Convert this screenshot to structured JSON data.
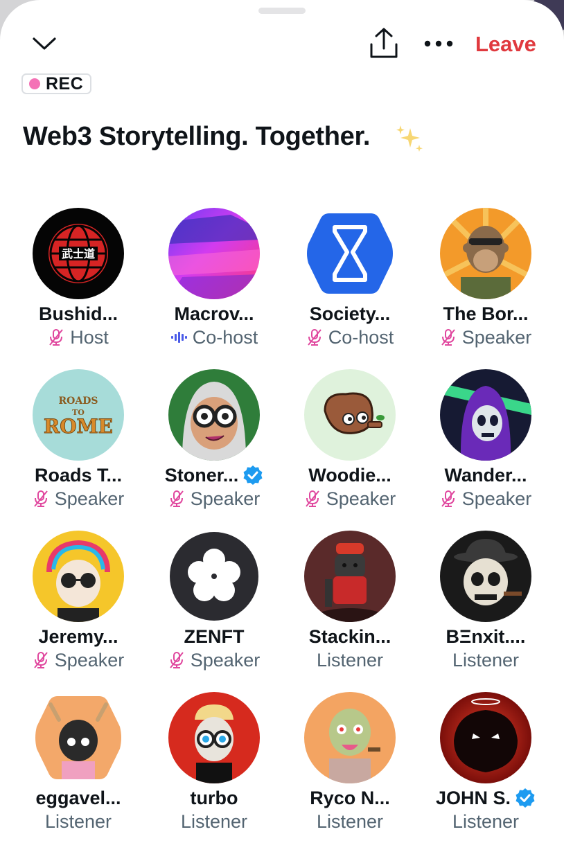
{
  "header": {
    "leave_label": "Leave",
    "collapse_icon": "chevron-down-icon",
    "share_icon": "share-icon",
    "more_icon": "more-horizontal-icon",
    "rec_label": "REC",
    "rec_color": "#f472b6",
    "leave_color": "#e0393e"
  },
  "space": {
    "title": "Web3 Storytelling. Together.",
    "title_emoji": "sparkles-icon"
  },
  "participants": [
    {
      "name": "Bushid...",
      "role": "Host",
      "status": "muted",
      "verified": false
    },
    {
      "name": "Macrov...",
      "role": "Co-host",
      "status": "speaking",
      "verified": false
    },
    {
      "name": "Society...",
      "role": "Co-host",
      "status": "muted",
      "verified": false
    },
    {
      "name": "The Bor...",
      "role": "Speaker",
      "status": "muted",
      "verified": false
    },
    {
      "name": "Roads T...",
      "role": "Speaker",
      "status": "muted",
      "verified": false
    },
    {
      "name": "Stoner...",
      "role": "Speaker",
      "status": "muted",
      "verified": true
    },
    {
      "name": "Woodie...",
      "role": "Speaker",
      "status": "muted",
      "verified": false
    },
    {
      "name": "Wander...",
      "role": "Speaker",
      "status": "muted",
      "verified": false
    },
    {
      "name": "Jeremy...",
      "role": "Speaker",
      "status": "muted",
      "verified": false
    },
    {
      "name": "ZENFT",
      "role": "Speaker",
      "status": "muted",
      "verified": false
    },
    {
      "name": "Stackin...",
      "role": "Listener",
      "status": "none",
      "verified": false
    },
    {
      "name": "BΞnxit....",
      "role": "Listener",
      "status": "none",
      "verified": false
    },
    {
      "name": "eggavel...",
      "role": "Listener",
      "status": "none",
      "verified": false
    },
    {
      "name": "turbo",
      "role": "Listener",
      "status": "none",
      "verified": false
    },
    {
      "name": "Ryco N...",
      "role": "Listener",
      "status": "none",
      "verified": false
    },
    {
      "name": "JOHN S.",
      "role": "Listener",
      "status": "none",
      "verified": true
    }
  ],
  "avatar_text": {
    "bushido": "武士道",
    "roads": "ROADS TO ROME"
  }
}
